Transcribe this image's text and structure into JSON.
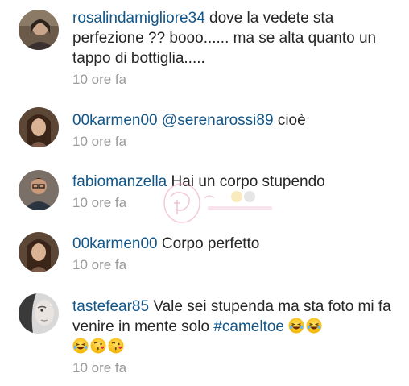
{
  "comments": [
    {
      "username": "rosalindamigliore34",
      "text": " dove la vedete sta perfezione ?? booo...... ma se alta quanto un tappo di bottiglia.....",
      "time": "10 ore fa",
      "avatar_icon": "avatar-photo"
    },
    {
      "username": "00karmen00",
      "mention": "@serenarossi89",
      "text": " cioè",
      "time": "10 ore fa",
      "avatar_icon": "avatar-photo"
    },
    {
      "username": "fabiomanzella",
      "text": " Hai un corpo stupendo",
      "time": "10 ore fa",
      "avatar_icon": "avatar-photo"
    },
    {
      "username": "00karmen00",
      "text": " Corpo perfetto",
      "time": "10 ore fa",
      "avatar_icon": "avatar-photo"
    },
    {
      "username": "tastefear85",
      "text": " Vale sei stupenda ma sta foto mi fa venire in mente solo ",
      "hashtag": "#cameltoe",
      "emojis_line1": [
        "laughing-emoji",
        "laughing-emoji"
      ],
      "emojis_line2": [
        "laughing-emoji",
        "kiss-emoji",
        "kiss-emoji"
      ],
      "time": "10 ore fa",
      "avatar_icon": "avatar-photo"
    }
  ],
  "watermark": {
    "icon": "watermark-logo"
  },
  "colors": {
    "username": "#125688",
    "text": "#262626",
    "time": "#9a9a9a",
    "background": "#ffffff"
  }
}
